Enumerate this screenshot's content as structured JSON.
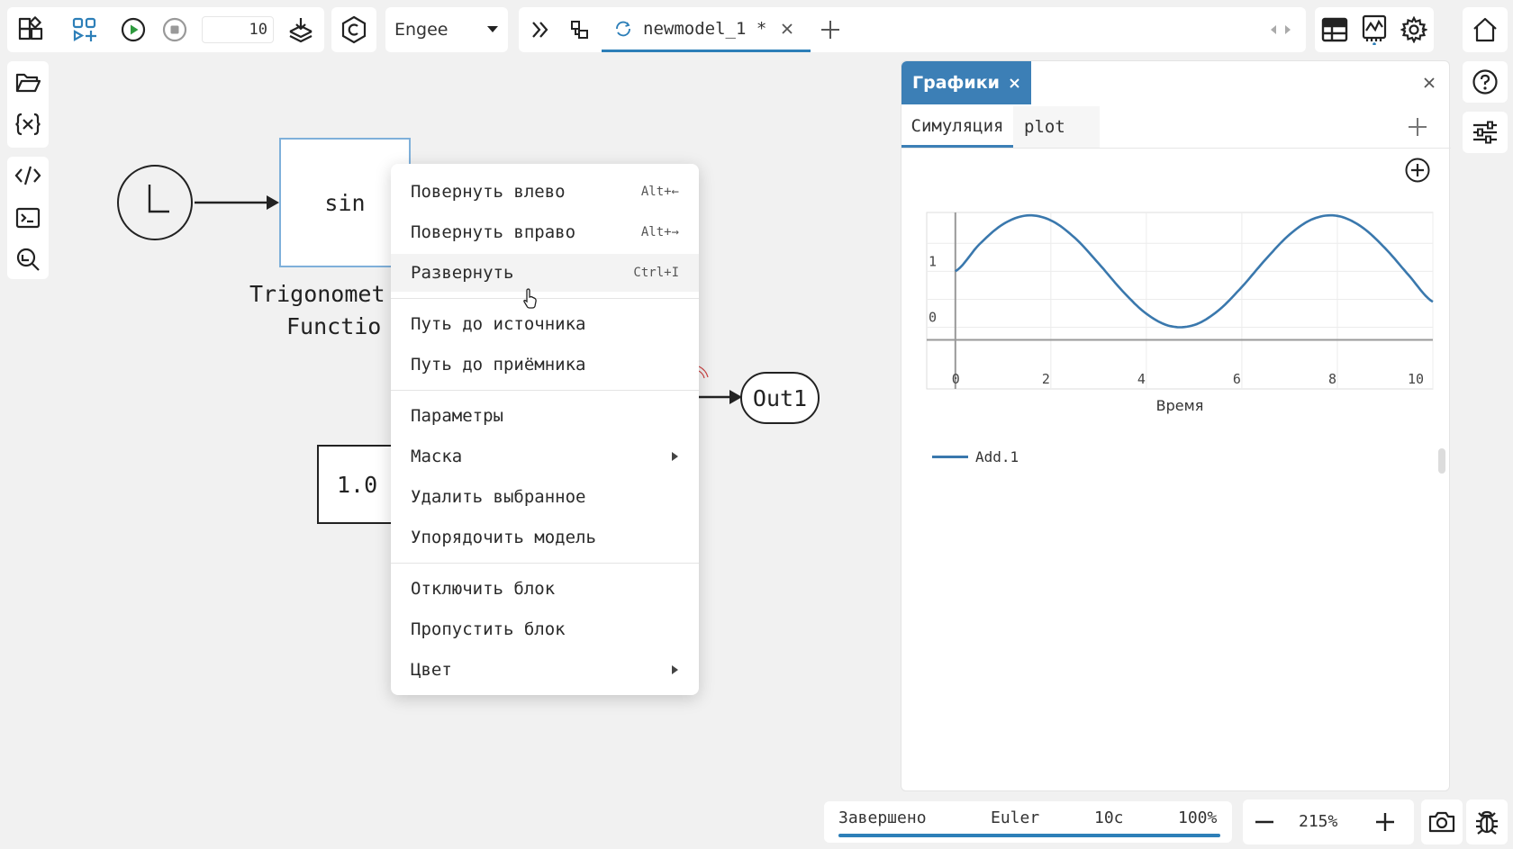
{
  "toolbar": {
    "sim_time_value": "10",
    "solver_label": "Engee",
    "tab_title": "newmodel_1 *",
    "accent_color": "#2d7fb8"
  },
  "canvas": {
    "sin_block_label": "sin",
    "trig_caption_line1": "Trigonomet",
    "trig_caption_line2": "Functio",
    "out_port_label": "Out1",
    "constant_label": "1.0"
  },
  "context_menu": {
    "items": [
      {
        "label": "Повернуть влево",
        "shortcut": "Alt+←"
      },
      {
        "label": "Повернуть вправо",
        "shortcut": "Alt+→"
      },
      {
        "label": "Развернуть",
        "shortcut": "Ctrl+I"
      },
      {
        "label": "Путь до источника"
      },
      {
        "label": "Путь до приёмника"
      },
      {
        "label": "Параметры"
      },
      {
        "label": "Маска"
      },
      {
        "label": "Удалить выбранное"
      },
      {
        "label": "Упорядочить модель"
      },
      {
        "label": "Отключить блок"
      },
      {
        "label": "Пропустить блок"
      },
      {
        "label": "Цвет"
      }
    ]
  },
  "plots": {
    "panel_tab": "Графики",
    "subtabs": [
      "Симуляция",
      "plot"
    ],
    "legend_entry": "Add.1"
  },
  "chart_data": {
    "type": "line",
    "title": "",
    "xlabel": "Время",
    "ylabel": "",
    "xlim": [
      -0.6,
      10
    ],
    "ylim": [
      -1.1,
      2.05
    ],
    "x_ticks": [
      "0",
      "2",
      "4",
      "6",
      "8",
      "10"
    ],
    "y_ticks": [
      "0",
      "1"
    ],
    "grid": true,
    "series": [
      {
        "name": "Add.1",
        "color": "#3a78ad",
        "x": [
          0,
          0.5,
          1,
          1.5,
          2,
          2.5,
          3,
          3.5,
          4,
          4.5,
          5,
          5.5,
          6,
          6.5,
          7,
          7.5,
          8,
          8.5,
          9,
          9.5,
          10
        ],
        "y": [
          1.0,
          1.479,
          1.841,
          1.997,
          1.909,
          1.598,
          1.141,
          0.649,
          0.243,
          0.022,
          0.041,
          0.295,
          0.721,
          1.215,
          1.657,
          1.938,
          1.989,
          1.798,
          1.412,
          0.925,
          0.456
        ]
      }
    ]
  },
  "status": {
    "state": "Завершено",
    "solver": "Euler",
    "time": "10с",
    "progress": "100%",
    "progress_fraction": 1.0,
    "zoom": "215%"
  }
}
